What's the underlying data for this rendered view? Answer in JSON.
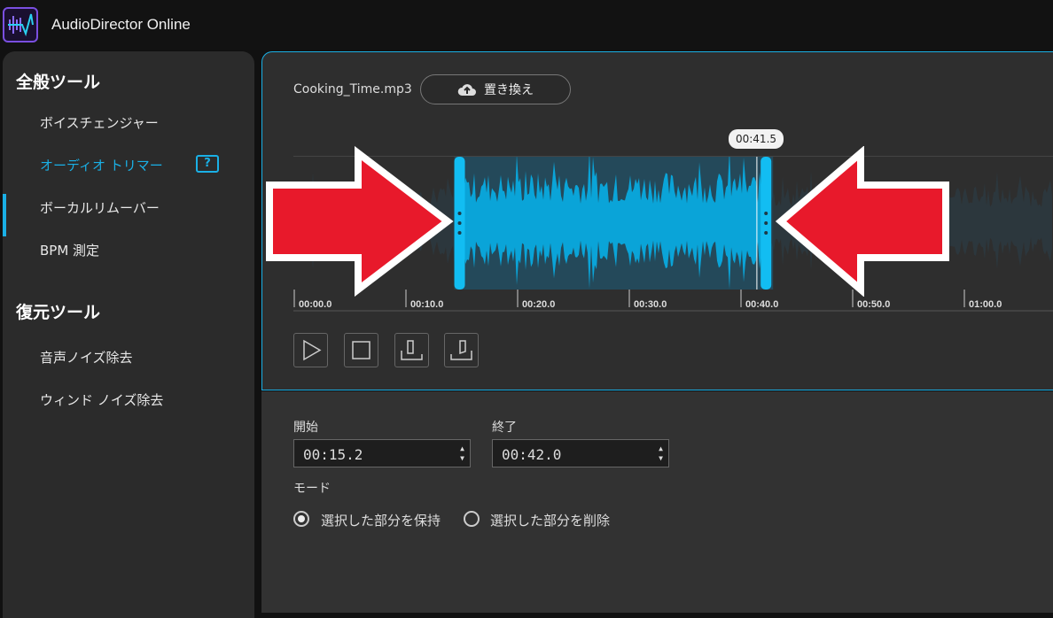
{
  "app": {
    "title": "AudioDirector Online",
    "accent": "#1ab0e6"
  },
  "sidebar": {
    "sections": [
      {
        "title": "全般ツール",
        "items": [
          {
            "label": "ボイスチェンジャー"
          },
          {
            "label": "オーディオ トリマー",
            "active": true
          },
          {
            "label": "ボーカルリムーバー"
          },
          {
            "label": "BPM 測定"
          }
        ]
      },
      {
        "title": "復元ツール",
        "items": [
          {
            "label": "音声ノイズ除去"
          },
          {
            "label": "ウィンド ノイズ除去"
          }
        ]
      }
    ],
    "help_icon": "?"
  },
  "file": {
    "name": "Cooking_Time.mp3",
    "replace_label": "置き換え",
    "replace_icon": "cloud-upload-icon"
  },
  "waveform": {
    "playhead_label": "00:41.5",
    "playhead_sec": 41.5,
    "selection_start_sec": 15.2,
    "selection_end_sec": 42.0,
    "ticks": [
      "00:00.0",
      "00:10.0",
      "00:20.0",
      "00:30.0",
      "00:40.0",
      "00:50.0",
      "01:00.0"
    ]
  },
  "controls": [
    {
      "icon": "play-icon"
    },
    {
      "icon": "stop-icon"
    },
    {
      "icon": "set-start-icon"
    },
    {
      "icon": "set-end-icon"
    }
  ],
  "trim": {
    "start_label": "開始",
    "start_value": "00:15.2",
    "end_label": "終了",
    "end_value": "00:42.0",
    "mode_label": "モード",
    "mode_options": [
      {
        "label": "選択した部分を保持",
        "selected": true
      },
      {
        "label": "選択した部分を削除",
        "selected": false
      }
    ]
  }
}
